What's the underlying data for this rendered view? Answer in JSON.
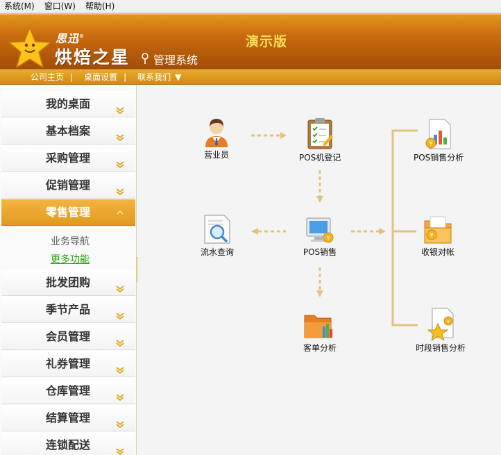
{
  "menu": [
    "系统(M)",
    "窗口(W)",
    "帮助(H)"
  ],
  "brand": {
    "small": "思迅",
    "reg": "®",
    "big": "烘焙之星",
    "sub": "管理系统",
    "edition": "演示版"
  },
  "nav": {
    "links": [
      "公司主页",
      "桌面设置",
      "联系我们"
    ],
    "dropdown_icon": "triangle-down-icon"
  },
  "sidebar": {
    "items": [
      {
        "label": "我的桌面"
      },
      {
        "label": "基本档案"
      },
      {
        "label": "采购管理"
      },
      {
        "label": "促销管理"
      },
      {
        "label": "零售管理",
        "active": true
      },
      {
        "label": "批发团购"
      },
      {
        "label": "季节产品"
      },
      {
        "label": "会员管理"
      },
      {
        "label": "礼券管理"
      },
      {
        "label": "仓库管理"
      },
      {
        "label": "结算管理"
      },
      {
        "label": "连锁配送"
      }
    ],
    "sub_nav": "业务导航",
    "sub_more": "更多功能"
  },
  "workflow": {
    "nodes": {
      "salesperson": "营业员",
      "pos_register": "POS机登记",
      "pos_sales_analysis": "POS销售分析",
      "flow_query": "流水查询",
      "pos_sales": "POS销售",
      "cash_reconcile": "收银对帐",
      "order_analysis": "客单分析",
      "period_sales_analysis": "时段销售分析"
    },
    "accent_color": "#e3c37a"
  }
}
